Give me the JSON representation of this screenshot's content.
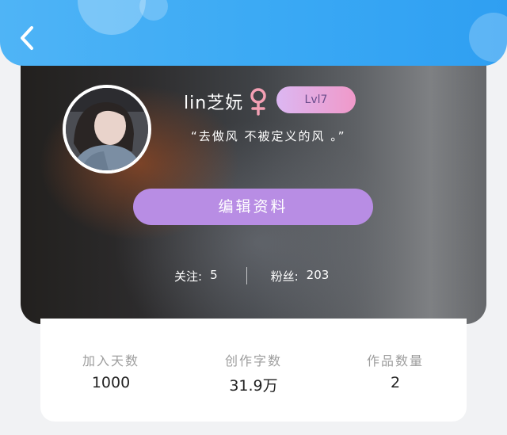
{
  "header": {
    "back_icon": "chevron-left-icon"
  },
  "profile": {
    "name": "lin芝妧",
    "gender_icon": "female-symbol-icon",
    "level": "Lvl7",
    "signature": "“去做风 不被定义的风 。”",
    "edit_button_label": "编辑资料",
    "following_label": "关注:",
    "following_count": "5",
    "followers_label": "粉丝:",
    "followers_count": "203"
  },
  "metrics": [
    {
      "label": "加入天数",
      "value": "1000"
    },
    {
      "label": "创作字数",
      "value": "31.9万"
    },
    {
      "label": "作品数量",
      "value": "2"
    }
  ],
  "colors": {
    "header": "#3aa9f4",
    "edit_button": "#b88de4",
    "level_badge_start": "#dcb7f2",
    "level_badge_end": "#f099c9",
    "female_symbol": "#f4a0b4"
  }
}
